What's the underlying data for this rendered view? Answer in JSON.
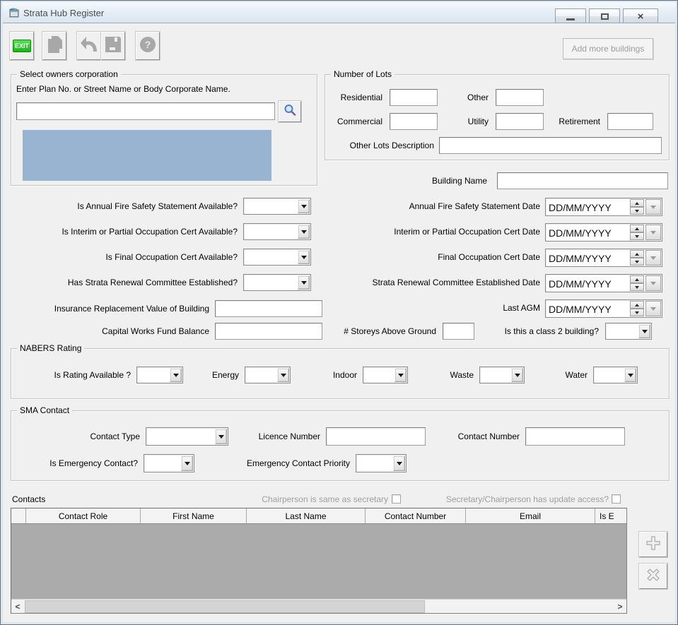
{
  "window": {
    "title": "Strata Hub Register"
  },
  "toolbar": {
    "exit_label": "EXIT",
    "add_more_buildings_label": "Add more buildings"
  },
  "owners_corp": {
    "group_title": "Select owners corporation",
    "search_hint": "Enter Plan No. or Street Name or Body Corporate Name.",
    "search_value": ""
  },
  "lots": {
    "group_title": "Number of Lots",
    "residential_label": "Residential",
    "residential_value": "",
    "other_label": "Other",
    "other_value": "",
    "commercial_label": "Commercial",
    "commercial_value": "",
    "utility_label": "Utility",
    "utility_value": "",
    "retirement_label": "Retirement",
    "retirement_value": "",
    "other_desc_label": "Other Lots Description",
    "other_desc_value": ""
  },
  "building": {
    "name_label": "Building Name",
    "name_value": ""
  },
  "questions": [
    {
      "label": "Is Annual Fire Safety Statement Available?",
      "value": ""
    },
    {
      "label": "Is Interim or Partial Occupation Cert Available?",
      "value": ""
    },
    {
      "label": "Is Final Occupation Cert Available?",
      "value": ""
    },
    {
      "label": "Has Strata Renewal Committee Established?",
      "value": ""
    }
  ],
  "dates": [
    {
      "label": "Annual Fire Safety Statement Date",
      "value": "DD/MM/YYYY"
    },
    {
      "label": "Interim or Partial Occupation Cert Date",
      "value": "DD/MM/YYYY"
    },
    {
      "label": "Final Occupation Cert Date",
      "value": "DD/MM/YYYY"
    },
    {
      "label": "Strata Renewal Committee Established Date",
      "value": "DD/MM/YYYY"
    },
    {
      "label": "Last AGM",
      "value": "DD/MM/YYYY"
    }
  ],
  "fields": {
    "insurance_label": "Insurance Replacement Value of Building",
    "insurance_value": "",
    "capital_label": "Capital Works Fund Balance",
    "capital_value": "",
    "storeys_label": "# Storeys Above Ground",
    "storeys_value": "",
    "class2_label": "Is this a class 2 building?",
    "class2_value": ""
  },
  "nabers": {
    "group_title": "NABERS Rating",
    "items": [
      {
        "label": "Is Rating Available ?",
        "value": ""
      },
      {
        "label": "Energy",
        "value": ""
      },
      {
        "label": "Indoor",
        "value": ""
      },
      {
        "label": "Waste",
        "value": ""
      },
      {
        "label": "Water",
        "value": ""
      }
    ]
  },
  "sma": {
    "group_title": "SMA Contact",
    "contact_type_label": "Contact Type",
    "contact_type_value": "",
    "licence_label": "Licence Number",
    "licence_value": "",
    "contact_number_label": "Contact Number",
    "contact_number_value": "",
    "emergency_label": "Is Emergency Contact?",
    "emergency_value": "",
    "priority_label": "Emergency Contact Priority",
    "priority_value": ""
  },
  "contacts": {
    "section_label": "Contacts",
    "chairperson_checkbox_label": "Chairperson is same as secretary",
    "secretary_checkbox_label": "Secretary/Chairperson has update access?",
    "headers": [
      "",
      "Contact Role",
      "First Name",
      "Last Name",
      "Contact Number",
      "Email",
      "Is E"
    ],
    "rows": []
  },
  "icons": {
    "app_icon": "form-window",
    "minimize_icon": "minimize-bar",
    "maximize_icon": "restore-box",
    "close_icon": "close-x",
    "exit_icon": "exit-door",
    "new_icon": "document",
    "undo_icon": "undo-arrow",
    "save_icon": "floppy-disk",
    "help_icon": "question-mark",
    "search_icon": "magnifier",
    "add_row_icon": "plus",
    "delete_row_icon": "cross",
    "chevron_down_icon": "triangle-down",
    "spinner_icons": "triangle-up-down",
    "scroll_left_icon": "chevron-left",
    "scroll_right_icon": "chevron-right"
  },
  "colors": {
    "listbox_blue": "#99B4D1",
    "exit_green": "#1EB91E",
    "table_body_gray": "#ABABAB",
    "client_bg": "#F0F0F0",
    "frame": "#DCE6F1"
  }
}
